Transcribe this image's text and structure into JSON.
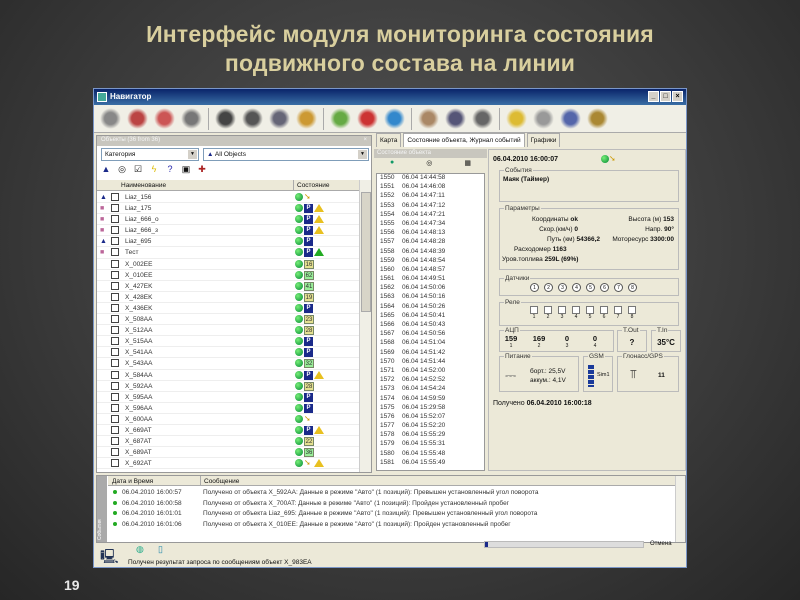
{
  "slide": {
    "title_line1": "Интерфейс модуля мониторинга состояния",
    "title_line2": "подвижного состава на линии",
    "page_number": "19"
  },
  "window": {
    "title": "Навигатор",
    "min": "_",
    "max": "□",
    "close": "×"
  },
  "objects_panel": {
    "header": "Объекты (36 from 36)",
    "category_combo": "Категория",
    "filter_combo": "All Objects",
    "col_name": "Наименование",
    "col_state": "Состояние",
    "rows": [
      {
        "name": "Liaz_156",
        "type": "tri",
        "st": [
          "dot",
          "arr"
        ]
      },
      {
        "name": "Liaz_175",
        "type": "bus",
        "st": [
          "dot",
          "P",
          "warn"
        ]
      },
      {
        "name": "Liaz_666_o",
        "type": "bus",
        "st": [
          "dot",
          "P",
          "warn"
        ]
      },
      {
        "name": "Liaz_666_з",
        "type": "bus",
        "st": [
          "dot",
          "P",
          "warn"
        ]
      },
      {
        "name": "Liaz_695",
        "type": "tri",
        "st": [
          "dot",
          "P"
        ]
      },
      {
        "name": "Тест",
        "type": "bus",
        "st": [
          "dot",
          "P",
          "warng"
        ]
      },
      {
        "name": "X_002EE",
        "st": [
          "dot",
          "16"
        ]
      },
      {
        "name": "X_010EE",
        "st": [
          "dot",
          "g62"
        ]
      },
      {
        "name": "X_427EK",
        "st": [
          "dot",
          "g41"
        ]
      },
      {
        "name": "X_428EK",
        "st": [
          "dot",
          "19"
        ]
      },
      {
        "name": "X_436EK",
        "st": [
          "dot",
          "P"
        ]
      },
      {
        "name": "X_508AA",
        "st": [
          "dot",
          "23"
        ]
      },
      {
        "name": "X_512AA",
        "st": [
          "dot",
          "28"
        ]
      },
      {
        "name": "X_515AA",
        "st": [
          "dot",
          "P"
        ]
      },
      {
        "name": "X_541AA",
        "st": [
          "dot",
          "P"
        ]
      },
      {
        "name": "X_543AA",
        "st": [
          "dot",
          "g32"
        ]
      },
      {
        "name": "X_584AA",
        "st": [
          "dot",
          "P",
          "warn"
        ]
      },
      {
        "name": "X_592AA",
        "st": [
          "dot",
          "28"
        ]
      },
      {
        "name": "X_595AA",
        "st": [
          "dot",
          "P"
        ]
      },
      {
        "name": "X_596AA",
        "st": [
          "dot",
          "P"
        ]
      },
      {
        "name": "X_600AA",
        "st": [
          "dot",
          "arr"
        ]
      },
      {
        "name": "X_669AT",
        "st": [
          "dot",
          "P",
          "warn"
        ]
      },
      {
        "name": "X_687AT",
        "st": [
          "dot",
          "22"
        ]
      },
      {
        "name": "X_689AT",
        "st": [
          "dot",
          "g36"
        ]
      },
      {
        "name": "X_692AT",
        "st": [
          "dot",
          "arr",
          "warn"
        ]
      }
    ]
  },
  "tabs": [
    "Карта",
    "Состояние объекта, Журнал событий",
    "Графики"
  ],
  "records_panel": {
    "header": "Состояние объекта",
    "records": [
      [
        "1550",
        "06.04",
        "14:44:58"
      ],
      [
        "1551",
        "06.04",
        "14:46:08"
      ],
      [
        "1552",
        "06.04",
        "14:47:11"
      ],
      [
        "1553",
        "06.04",
        "14:47:12"
      ],
      [
        "1554",
        "06.04",
        "14:47:21"
      ],
      [
        "1555",
        "06.04",
        "14:47:34"
      ],
      [
        "1556",
        "06.04",
        "14:48:13"
      ],
      [
        "1557",
        "06.04",
        "14:48:28"
      ],
      [
        "1558",
        "06.04",
        "14:48:39"
      ],
      [
        "1559",
        "06.04",
        "14:48:54"
      ],
      [
        "1560",
        "06.04",
        "14:48:57"
      ],
      [
        "1561",
        "06.04",
        "14:49:51"
      ],
      [
        "1562",
        "06.04",
        "14:50:06"
      ],
      [
        "1563",
        "06.04",
        "14:50:16"
      ],
      [
        "1564",
        "06.04",
        "14:50:26"
      ],
      [
        "1565",
        "06.04",
        "14:50:41"
      ],
      [
        "1566",
        "06.04",
        "14:50:43"
      ],
      [
        "1567",
        "06.04",
        "14:50:56"
      ],
      [
        "1568",
        "06.04",
        "14:51:04"
      ],
      [
        "1569",
        "06.04",
        "14:51:42"
      ],
      [
        "1570",
        "06.04",
        "14:51:44"
      ],
      [
        "1571",
        "06.04",
        "14:52:00"
      ],
      [
        "1572",
        "06.04",
        "14:52:52"
      ],
      [
        "1573",
        "06.04",
        "14:54:24"
      ],
      [
        "1574",
        "06.04",
        "14:59:59"
      ],
      [
        "1575",
        "06.04",
        "15:29:58"
      ],
      [
        "1576",
        "06.04",
        "15:52:07"
      ],
      [
        "1577",
        "06.04",
        "15:52:20"
      ],
      [
        "1578",
        "06.04",
        "15:55:29"
      ],
      [
        "1579",
        "06.04",
        "15:55:31"
      ],
      [
        "1580",
        "06.04",
        "15:55:48"
      ],
      [
        "1581",
        "06.04",
        "15:55:49"
      ]
    ]
  },
  "state": {
    "datetime": "06.04.2010 16:00:07",
    "events_label": "События",
    "event": "Маяк (Таймер)",
    "params_label": "Параметры",
    "coords_label": "Координаты",
    "coords": "ok",
    "alt_label": "Высота (м)",
    "alt": "153",
    "speed_label": "Скор.(км/ч)",
    "speed": "0",
    "dir_label": "Напр.",
    "dir": "90°",
    "path_label": "Путь (км)",
    "path": "54366,2",
    "motor_label": "Моторесурс",
    "motor": "3300:00",
    "flow_label": "Расходомер",
    "flow": "1163",
    "fuel_label": "Уров.топлива",
    "fuel": "259L (69%)",
    "sensors_label": "Датчики",
    "sensors": [
      "1",
      "2",
      "3",
      "4",
      "5",
      "6",
      "7",
      "8"
    ],
    "relay_label": "Реле",
    "relays": [
      "1",
      "2",
      "3",
      "4",
      "5",
      "6",
      "7",
      "8"
    ],
    "adc_label": "АЦП",
    "adc": [
      [
        "159",
        "1"
      ],
      [
        "169",
        "2"
      ],
      [
        "0",
        "3"
      ],
      [
        "0",
        "4"
      ]
    ],
    "tout_label": "T.Out",
    "tout": "?",
    "tin_label": "T.In",
    "tin": "35°C",
    "power_label": "Питание",
    "board": "борт.: 25,5V",
    "battery": "аккум.: 4,1V",
    "gsm_label": "GSM",
    "gsm_sim": "Sim1",
    "gps_label": "Глонасс/GPS",
    "gps_sats": "11",
    "received_label": "Получено",
    "received": "06.04.2010 16:00:18"
  },
  "log": {
    "side_label": "События",
    "col_date": "Дата и Время",
    "col_msg": "Сообщение",
    "rows": [
      [
        "06.04.2010 16:00:57",
        "Получено от объекта X_592AA: Данные в режиме \"Авто\" (1 позиций): Превышен установленный угол поворота"
      ],
      [
        "06.04.2010 16:00:58",
        "Получено от объекта X_700AT: Данные в режиме \"Авто\" (1 позиций): Пройден установленный пробег"
      ],
      [
        "06.04.2010 16:01:01",
        "Получено от объекта Liaz_695: Данные в режиме \"Авто\" (1 позиций): Превышен установленный угол поворота"
      ],
      [
        "06.04.2010 16:01:06",
        "Получено от объекта X_010EE: Данные в режиме \"Авто\" (1 позиций): Пройден установленный пробег"
      ]
    ]
  },
  "status": {
    "message": "Получен результат запроса по сообщениям объект X_983EA",
    "cancel": "Отмена",
    "progress": 0.02
  },
  "toolbar_icons": [
    "wrench-icon",
    "car-search-icon",
    "car-alert-icon",
    "printer-icon",
    "panel-icon",
    "book-icon",
    "scatter-icon",
    "folder-open-icon",
    "road-icon",
    "chart-icon",
    "map-icon",
    "hand-icon",
    "magnifier-icon",
    "ruler-icon",
    "folder-arrow-icon",
    "paperclip-icon",
    "zoom-map-icon",
    "settings-icon"
  ]
}
